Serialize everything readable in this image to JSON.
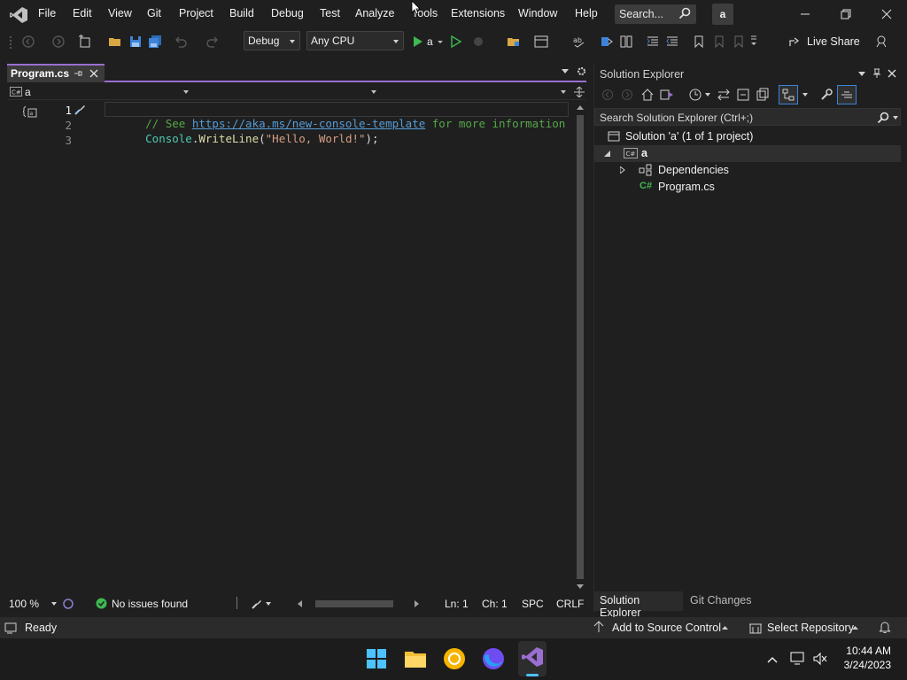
{
  "colors": {
    "accent": "#9b6ed1",
    "background": "#1f1f1f",
    "comment": "#57a64a",
    "link": "#569cd6",
    "string": "#d69d85",
    "type": "#4ec9b0",
    "method": "#dcdcaa",
    "ok": "#3fb950"
  },
  "menu": {
    "items": [
      "File",
      "Edit",
      "View",
      "Git",
      "Project",
      "Build",
      "Debug",
      "Test",
      "Analyze",
      "Tools",
      "Extensions",
      "Window",
      "Help"
    ],
    "search": "Search...",
    "profile": "a"
  },
  "toolbar": {
    "configuration": "Debug",
    "platform": "Any CPU",
    "run_target": "a",
    "live_share": "Live Share"
  },
  "editor": {
    "tab_label": "Program.cs",
    "nav_project": "a",
    "lines": [
      "1",
      "2",
      "3"
    ],
    "code": {
      "comment_prefix": "// See ",
      "comment_link": "https://aka.ms/new-console-template",
      "comment_suffix": " for more information",
      "line2_type": "Console",
      "line2_dot": ".",
      "line2_method": "WriteLine",
      "line2_open": "(",
      "line2_string": "\"Hello, World!\"",
      "line2_close": ");"
    },
    "status": {
      "zoom": "100 %",
      "issues": "No issues found",
      "line": "Ln: 1",
      "char": "Ch: 1",
      "whitespace": "SPC",
      "line_ending": "CRLF"
    }
  },
  "solution_explorer": {
    "title": "Solution Explorer",
    "search_placeholder": "Search Solution Explorer (Ctrl+;)",
    "solution": "Solution 'a' (1 of 1 project)",
    "project": "a",
    "dependencies": "Dependencies",
    "file": "Program.cs",
    "tabs": [
      "Solution Explorer",
      "Git Changes"
    ]
  },
  "statusbar": {
    "ready": "Ready",
    "source_control": "Add to Source Control",
    "repository": "Select Repository"
  },
  "taskbar": {
    "time": "10:44 AM",
    "date": "3/24/2023"
  }
}
